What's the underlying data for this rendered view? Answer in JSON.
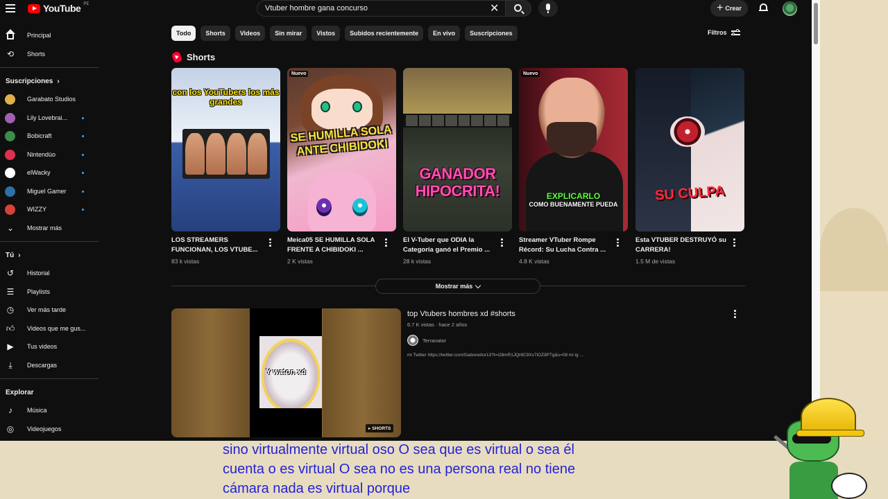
{
  "header": {
    "logo_text": "YouTube",
    "country": "PE",
    "search_value": "Vtuber hombre gana concurso",
    "create_label": "Crear"
  },
  "sidebar": {
    "top": [
      {
        "label": "Principal",
        "icon": "home-icon"
      },
      {
        "label": "Shorts",
        "icon": "shorts-icon"
      }
    ],
    "subs_heading": "Suscripciones",
    "subs": [
      {
        "label": "Garabato Studios",
        "color": "#e2b04a",
        "dot": false
      },
      {
        "label": "Lily Lovebrai...",
        "color": "#a35fb3",
        "dot": true
      },
      {
        "label": "Bobicraft",
        "color": "#3d8c4b",
        "dot": true
      },
      {
        "label": "Nintendúo",
        "color": "#e0304f",
        "dot": true
      },
      {
        "label": "elWacky",
        "color": "#ffffff",
        "dot": true
      },
      {
        "label": "Miguel Gamer",
        "color": "#2f6fa8",
        "dot": true
      },
      {
        "label": "WIZZY",
        "color": "#d6423a",
        "dot": true
      }
    ],
    "more_label": "Mostrar más",
    "you_heading": "Tú",
    "you": [
      {
        "label": "Historial",
        "icon": "history-icon"
      },
      {
        "label": "Playlists",
        "icon": "playlist-icon"
      },
      {
        "label": "Ver más tarde",
        "icon": "clock-icon"
      },
      {
        "label": "Videos que me gus...",
        "icon": "thumb-up-icon"
      },
      {
        "label": "Tus videos",
        "icon": "video-icon"
      },
      {
        "label": "Descargas",
        "icon": "download-icon"
      }
    ],
    "explore_heading": "Explorar",
    "explore": [
      {
        "label": "Música",
        "icon": "music-icon"
      },
      {
        "label": "Videojuegos",
        "icon": "gamepad-icon"
      }
    ]
  },
  "chips": [
    "Todo",
    "Shorts",
    "Videos",
    "Sin mirar",
    "Vistos",
    "Subidos recientemente",
    "En vivo",
    "Suscripciones"
  ],
  "filters_label": "Filtros",
  "shorts": {
    "heading": "Shorts",
    "items": [
      {
        "title": "LOS STREAMERS FUNCIONAN, LOS VTUBE...",
        "views": "83 k vistas",
        "badge": "",
        "caption": "con los YouTubers los más grandes"
      },
      {
        "title": "Meica05 SE HUMILLA SOLA FRENTE A CHIBIDOKI ...",
        "views": "2 K vistas",
        "badge": "Nuevo",
        "caption": "SE HUMILLA SOLA ANTE CHIBIDOKI"
      },
      {
        "title": "El V-Tuber que ODIA la Categoría ganó el Premio ...",
        "views": "28 k vistas",
        "badge": "",
        "caption": "GANADOR HIPOCRITA!"
      },
      {
        "title": "Streamer VTuber Rompe Récord: Su Lucha Contra ...",
        "views": "4.8 K vistas",
        "badge": "Nuevo",
        "caption_a": "EXPLICARLO",
        "caption_b": "COMO BUENAMENTE PUEDA"
      },
      {
        "title": "Esta VTUBER DESTRUYÓ su CARRERA!",
        "views": "1.5 M de vistas",
        "badge": "",
        "caption": "SU CULPA"
      }
    ],
    "more_label": "Mostrar más"
  },
  "video": {
    "title": "top Vtubers hombres xd #shorts",
    "meta": "6.7 K vistas · hace 2 años",
    "channel": "Terranator",
    "description": "mi Twitter https://twitter.com/Gaboneitor13?t=i28mR1JQr8C9Xv7iOZ9PTg&s=08 mi ig ...",
    "thumb_text": "Y waton xd",
    "badge": "SHORTS"
  },
  "subtitles": [
    "sino virtualmente virtual oso O sea que es virtual o sea él",
    "cuenta o es virtual O sea no es una persona real no tiene",
    "cámara nada es virtual porque"
  ]
}
